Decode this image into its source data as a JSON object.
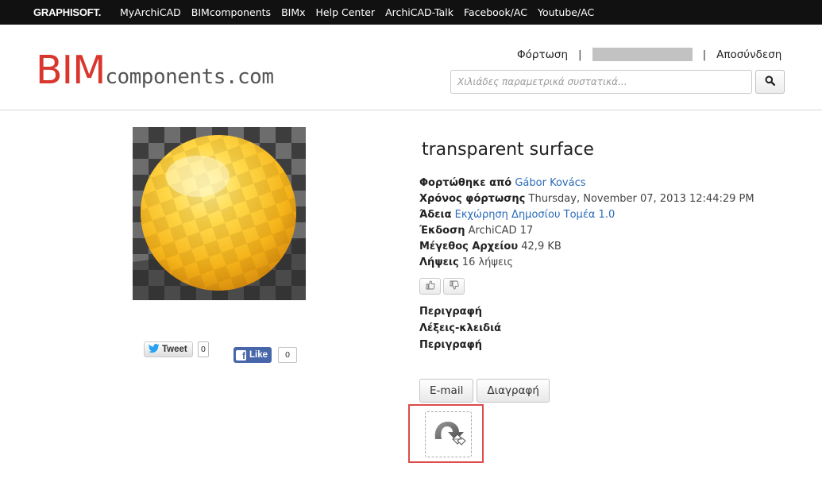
{
  "topnav": {
    "brand": "GRAPHISOFT.",
    "links": [
      "MyArchiCAD",
      "BIMcomponents",
      "BIMx",
      "Help Center",
      "ArchiCAD-Talk",
      "Facebook/AC",
      "Youtube/AC"
    ]
  },
  "header": {
    "logo_bim": "BIM",
    "logo_rest": "components.com",
    "upload_label": "Φόρτωση",
    "separator": "|",
    "logout_label": "Αποσύνδεση",
    "search_placeholder": "Χιλιάδες παραμετρικά συστατικά...",
    "search_icon": "search-icon"
  },
  "component": {
    "title": "transparent surface",
    "uploaded_by_label": "Φορτώθηκε από",
    "uploaded_by_value": "Gábor Kovács",
    "upload_time_label": "Χρόνος φόρτωσης",
    "upload_time_value": "Thursday, November 07, 2013 12:44:29 PM",
    "license_label": "Άδεια",
    "license_value": "Εκχώρηση Δημοσίου Τομέα 1.0",
    "version_label": "Έκδοση",
    "version_value": "ArchiCAD 17",
    "filesize_label": "Μέγεθος Αρχείου",
    "filesize_value": "42,9 KB",
    "downloads_label": "Λήψεις",
    "downloads_value": "16 λήψεις",
    "description_heading": "Περιγραφή",
    "keywords_heading": "Λέξεις-κλειδιά",
    "description_heading_2": "Περιγραφή"
  },
  "social": {
    "tweet_label": "Tweet",
    "tweet_count": "0",
    "like_label": "Like",
    "like_count": "0"
  },
  "actions": {
    "email_label": "E-mail",
    "delete_label": "Διαγραφή"
  },
  "colors": {
    "topbar_bg": "#111111",
    "logo_red": "#d9362e",
    "link_blue": "#2a6ab9",
    "facebook_blue": "#4867aa",
    "highlight_red": "#dd4b4b"
  }
}
